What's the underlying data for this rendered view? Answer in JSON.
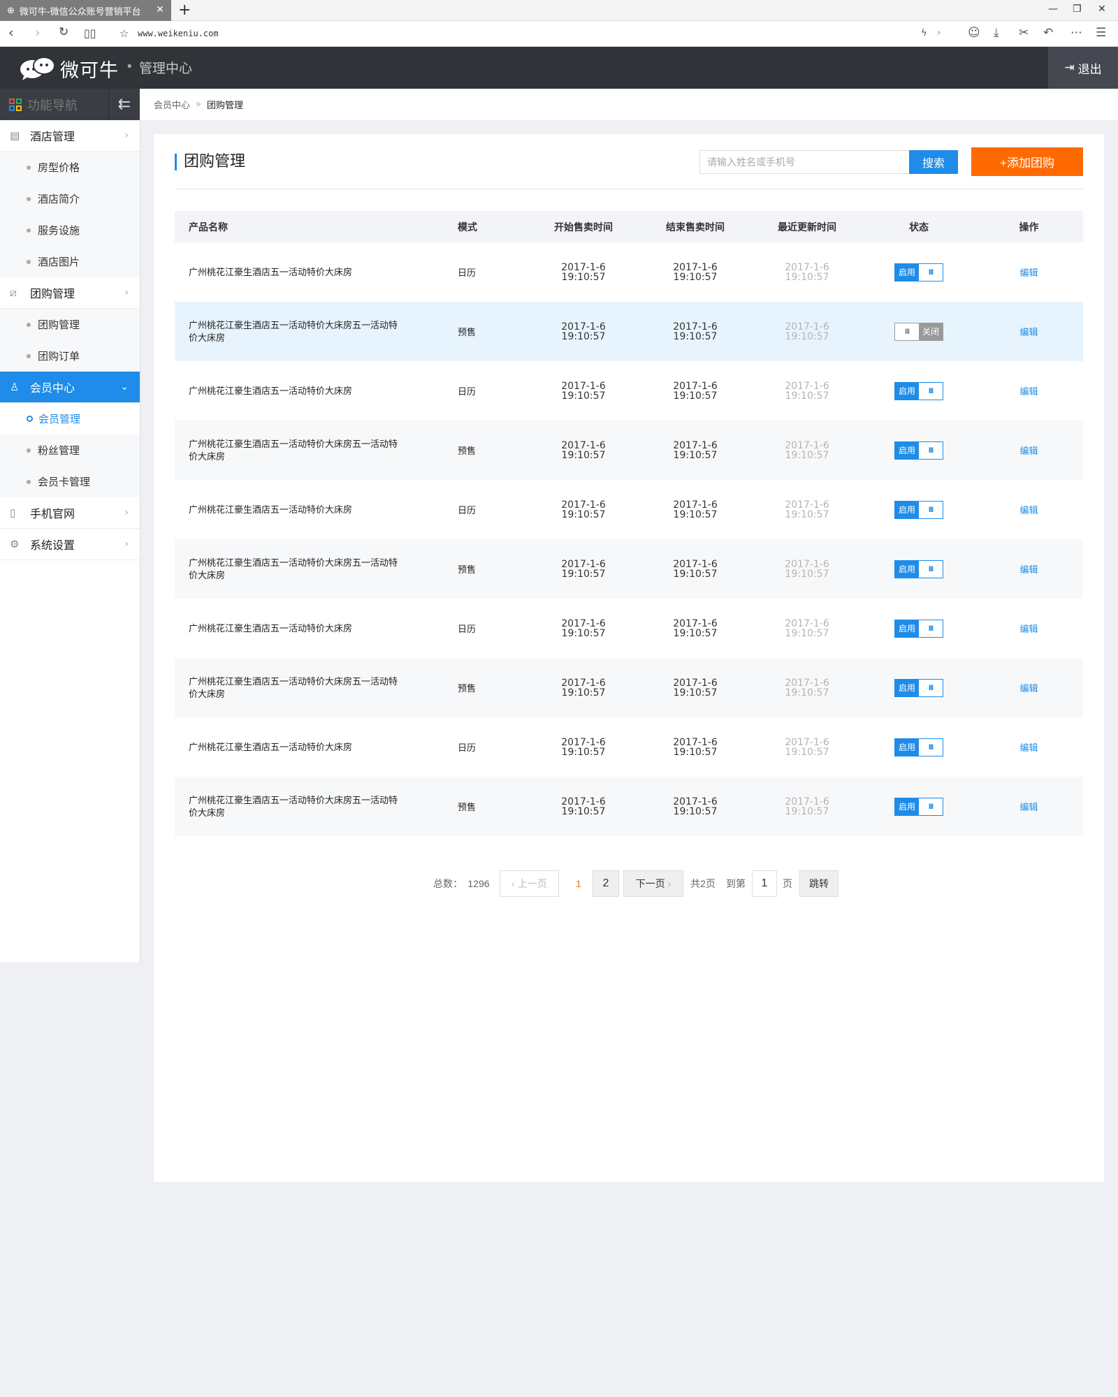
{
  "browser": {
    "tab_title": "微可牛-微信公众账号营销平台",
    "url": "www.weikeniu.com"
  },
  "header": {
    "brand": "微可牛",
    "subtitle": "管理中心",
    "logout": "退出",
    "bg_color": "#303338"
  },
  "sidebar": {
    "title": "功能导航",
    "groups": [
      {
        "label": "酒店管理",
        "icon": "document-icon",
        "items": [
          "房型价格",
          "酒店简介",
          "服务设施",
          "酒店图片"
        ]
      },
      {
        "label": "团购管理",
        "icon": "edit-icon",
        "items": [
          "团购管理",
          "团购订单"
        ]
      },
      {
        "label": "会员中心",
        "icon": "user-icon",
        "items": [
          "会员管理",
          "粉丝管理",
          "会员卡管理"
        ],
        "active": true,
        "active_item": "会员管理"
      },
      {
        "label": "手机官网",
        "icon": "phone-icon",
        "items": []
      },
      {
        "label": "系统设置",
        "icon": "gear-icon",
        "items": []
      }
    ],
    "accent_color": "#1e8ce8"
  },
  "breadcrumb": {
    "parent": "会员中心",
    "current": "团购管理"
  },
  "main": {
    "title": "团购管理",
    "search_placeholder": "请输入姓名或手机号",
    "search_button": "搜索",
    "add_button": "+添加团购",
    "add_button_color": "#ff6a00"
  },
  "table": {
    "headers": [
      "产品名称",
      "模式",
      "开始售卖时间",
      "结束售卖时间",
      "最近更新时间",
      "状态",
      "操作"
    ],
    "rows": [
      {
        "name": "广州桃花江豪生酒店五一活动特价大床房",
        "mode": "日历",
        "start": [
          "2017-1-6",
          "19:10:57"
        ],
        "end": [
          "2017-1-6",
          "19:10:57"
        ],
        "updated": [
          "2017-1-6",
          "19:10:57"
        ],
        "status": "启用",
        "on": true,
        "action": "编辑"
      },
      {
        "name": "广州桃花江豪生酒店五一活动特价大床房五一活动特价大床房",
        "mode": "预售",
        "start": [
          "2017-1-6",
          "19:10:57"
        ],
        "end": [
          "2017-1-6",
          "19:10:57"
        ],
        "updated": [
          "2017-1-6",
          "19:10:57"
        ],
        "status": "关闭",
        "on": false,
        "action": "编辑"
      },
      {
        "name": "广州桃花江豪生酒店五一活动特价大床房",
        "mode": "日历",
        "start": [
          "2017-1-6",
          "19:10:57"
        ],
        "end": [
          "2017-1-6",
          "19:10:57"
        ],
        "updated": [
          "2017-1-6",
          "19:10:57"
        ],
        "status": "启用",
        "on": true,
        "action": "编辑"
      },
      {
        "name": "广州桃花江豪生酒店五一活动特价大床房五一活动特价大床房",
        "mode": "预售",
        "start": [
          "2017-1-6",
          "19:10:57"
        ],
        "end": [
          "2017-1-6",
          "19:10:57"
        ],
        "updated": [
          "2017-1-6",
          "19:10:57"
        ],
        "status": "启用",
        "on": true,
        "action": "编辑"
      },
      {
        "name": "广州桃花江豪生酒店五一活动特价大床房",
        "mode": "日历",
        "start": [
          "2017-1-6",
          "19:10:57"
        ],
        "end": [
          "2017-1-6",
          "19:10:57"
        ],
        "updated": [
          "2017-1-6",
          "19:10:57"
        ],
        "status": "启用",
        "on": true,
        "action": "编辑"
      },
      {
        "name": "广州桃花江豪生酒店五一活动特价大床房五一活动特价大床房",
        "mode": "预售",
        "start": [
          "2017-1-6",
          "19:10:57"
        ],
        "end": [
          "2017-1-6",
          "19:10:57"
        ],
        "updated": [
          "2017-1-6",
          "19:10:57"
        ],
        "status": "启用",
        "on": true,
        "action": "编辑"
      },
      {
        "name": "广州桃花江豪生酒店五一活动特价大床房",
        "mode": "日历",
        "start": [
          "2017-1-6",
          "19:10:57"
        ],
        "end": [
          "2017-1-6",
          "19:10:57"
        ],
        "updated": [
          "2017-1-6",
          "19:10:57"
        ],
        "status": "启用",
        "on": true,
        "action": "编辑"
      },
      {
        "name": "广州桃花江豪生酒店五一活动特价大床房五一活动特价大床房",
        "mode": "预售",
        "start": [
          "2017-1-6",
          "19:10:57"
        ],
        "end": [
          "2017-1-6",
          "19:10:57"
        ],
        "updated": [
          "2017-1-6",
          "19:10:57"
        ],
        "status": "启用",
        "on": true,
        "action": "编辑"
      },
      {
        "name": "广州桃花江豪生酒店五一活动特价大床房",
        "mode": "日历",
        "start": [
          "2017-1-6",
          "19:10:57"
        ],
        "end": [
          "2017-1-6",
          "19:10:57"
        ],
        "updated": [
          "2017-1-6",
          "19:10:57"
        ],
        "status": "启用",
        "on": true,
        "action": "编辑"
      },
      {
        "name": "广州桃花江豪生酒店五一活动特价大床房五一活动特价大床房",
        "mode": "预售",
        "start": [
          "2017-1-6",
          "19:10:57"
        ],
        "end": [
          "2017-1-6",
          "19:10:57"
        ],
        "updated": [
          "2017-1-6",
          "19:10:57"
        ],
        "status": "启用",
        "on": true,
        "action": "编辑"
      }
    ],
    "toggle_knob": "III",
    "highlight_row_index": 1
  },
  "pagination": {
    "total_label": "总数：",
    "total": "1296",
    "prev": "上一页",
    "pages": [
      "1",
      "2"
    ],
    "current_page": "1",
    "next": "下一页",
    "page_count": "共2页",
    "goto_label": "到第",
    "goto_value": "1",
    "page_unit": "页",
    "goto_button": "跳转"
  }
}
